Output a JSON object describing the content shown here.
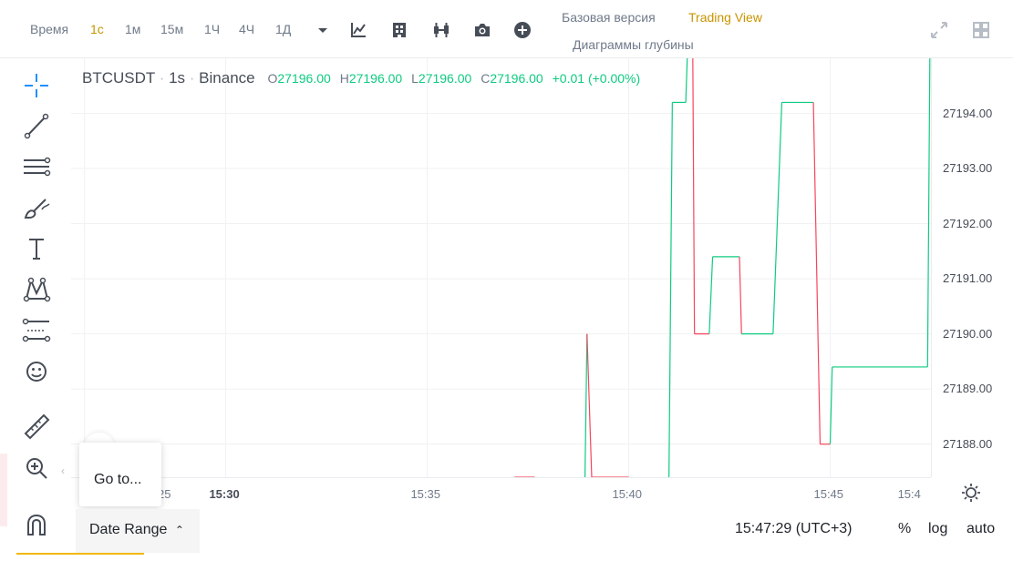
{
  "toolbar": {
    "time_label": "Время",
    "timeframes": [
      "1с",
      "1м",
      "15м",
      "1Ч",
      "4Ч",
      "1Д"
    ],
    "active_timeframe": "1с",
    "view_basic": "Базовая версия",
    "view_tradingview": "Trading View",
    "view_depth": "Диаграммы глубины"
  },
  "legend": {
    "symbol": "BTCUSDT",
    "interval": "1s",
    "exchange": "Binance",
    "open_label": "O",
    "open": "27196.00",
    "high_label": "H",
    "high": "27196.00",
    "low_label": "L",
    "low": "27196.00",
    "close_label": "C",
    "close": "27196.00",
    "change": "+0.01 (+0.00%)"
  },
  "price_axis": [
    "27194.00",
    "27193.00",
    "27192.00",
    "27191.00",
    "27190.00",
    "27189.00",
    "27188.00"
  ],
  "time_axis": [
    {
      "label": "25",
      "bold": false
    },
    {
      "label": "15:30",
      "bold": true
    },
    {
      "label": "15:35",
      "bold": false
    },
    {
      "label": "15:40",
      "bold": false
    },
    {
      "label": "15:45",
      "bold": false
    },
    {
      "label": "15:4",
      "bold": false
    }
  ],
  "goto_label": "Go to...",
  "date_range_label": "Date Range",
  "clock": "15:47:29 (UTC+3)",
  "bottom_options": [
    "%",
    "log",
    "auto"
  ],
  "colors": {
    "up": "#0ecb81",
    "down": "#f6465d",
    "accent": "#c99400",
    "grid": "#f0f1f3"
  },
  "chart_data": {
    "type": "line",
    "segments": [
      {
        "x": [
          "15:37:10",
          "15:37:40"
        ],
        "y": [
          27187.4,
          27187.4
        ],
        "dir": "down"
      },
      {
        "x": [
          "15:38:55",
          "15:38:58"
        ],
        "y": [
          27187.4,
          27190.0
        ],
        "dir": "up"
      },
      {
        "x": [
          "15:38:58",
          "15:39:05"
        ],
        "y": [
          27190.0,
          27187.4
        ],
        "dir": "down"
      },
      {
        "x": [
          "15:39:05",
          "15:40:00"
        ],
        "y": [
          27187.4,
          27187.4
        ],
        "dir": "down"
      },
      {
        "x": [
          "15:41:00",
          "15:41:05"
        ],
        "y": [
          27187.4,
          27194.2
        ],
        "dir": "up"
      },
      {
        "x": [
          "15:41:05",
          "15:41:25"
        ],
        "y": [
          27194.2,
          27194.2
        ],
        "dir": "up"
      },
      {
        "x": [
          "15:41:25",
          "15:41:30"
        ],
        "y": [
          27194.2,
          27196.0
        ],
        "dir": "up"
      },
      {
        "x": [
          "15:41:35",
          "15:41:38"
        ],
        "y": [
          27196.0,
          27190.0
        ],
        "dir": "down"
      },
      {
        "x": [
          "15:41:38",
          "15:42:00"
        ],
        "y": [
          27190.0,
          27190.0
        ],
        "dir": "down"
      },
      {
        "x": [
          "15:42:00",
          "15:42:05"
        ],
        "y": [
          27190.0,
          27191.4
        ],
        "dir": "up"
      },
      {
        "x": [
          "15:42:05",
          "15:42:45"
        ],
        "y": [
          27191.4,
          27191.4
        ],
        "dir": "up"
      },
      {
        "x": [
          "15:42:45",
          "15:42:48"
        ],
        "y": [
          27191.4,
          27190.0
        ],
        "dir": "down"
      },
      {
        "x": [
          "15:42:48",
          "15:43:35"
        ],
        "y": [
          27190.0,
          27190.0
        ],
        "dir": "up"
      },
      {
        "x": [
          "15:43:35",
          "15:43:48"
        ],
        "y": [
          27190.0,
          27194.2
        ],
        "dir": "up"
      },
      {
        "x": [
          "15:43:48",
          "15:44:35"
        ],
        "y": [
          27194.2,
          27194.2
        ],
        "dir": "up"
      },
      {
        "x": [
          "15:44:35",
          "15:44:45"
        ],
        "y": [
          27194.2,
          27188.0
        ],
        "dir": "down"
      },
      {
        "x": [
          "15:44:45",
          "15:45:00"
        ],
        "y": [
          27188.0,
          27188.0
        ],
        "dir": "down"
      },
      {
        "x": [
          "15:45:00",
          "15:45:03"
        ],
        "y": [
          27188.0,
          27189.4
        ],
        "dir": "up"
      },
      {
        "x": [
          "15:45:03",
          "15:47:25"
        ],
        "y": [
          27189.4,
          27189.4
        ],
        "dir": "up"
      },
      {
        "x": [
          "15:47:25",
          "15:47:29"
        ],
        "y": [
          27189.4,
          27196.0
        ],
        "dir": "up"
      }
    ],
    "ylim": [
      27187.4,
      27195.0
    ],
    "xlim": [
      "15:26:10",
      "15:47:30"
    ],
    "grid": true
  }
}
